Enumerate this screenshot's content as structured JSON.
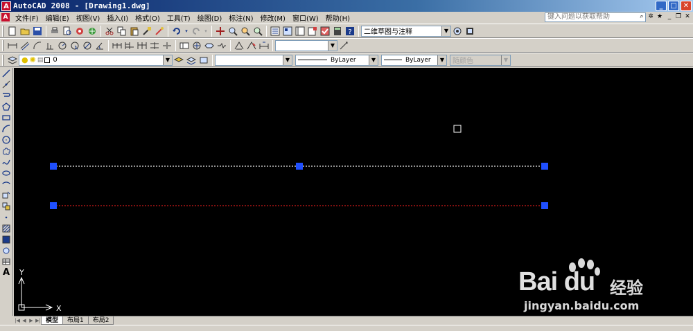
{
  "window": {
    "title": "AutoCAD 2008 - [Drawing1.dwg]",
    "app_icon_letter": "A",
    "controls": {
      "minimize": "_",
      "maximize": "□",
      "close": "✕"
    }
  },
  "menubar": {
    "items": [
      "文件(F)",
      "编辑(E)",
      "视图(V)",
      "插入(I)",
      "格式(O)",
      "工具(T)",
      "绘图(D)",
      "标注(N)",
      "修改(M)",
      "窗口(W)",
      "帮助(H)"
    ],
    "help_placeholder": "键入问题以获取帮助"
  },
  "toolbar_standard": {
    "workspace_value": "二维草图与注释"
  },
  "toolbar_dimension": {
    "dimstyle_value": ""
  },
  "toolbar_layers": {
    "layer_value": "0",
    "layer_state_value": ""
  },
  "toolbar_properties": {
    "color_value": "",
    "linetype_value": "ByLayer",
    "lineweight_value": "ByLayer",
    "plotstyle_value": "随颜色"
  },
  "left_palette": {
    "text_tool_label": "A"
  },
  "canvas": {
    "background": "#000000",
    "grip_color": "#1f4fff",
    "line1_color": "#e6e6e6",
    "line2_color": "#cc1a1a",
    "ucs_x_label": "X",
    "ucs_y_label": "Y"
  },
  "layout_tabs": [
    {
      "label": "模型",
      "active": true
    },
    {
      "label": "布局1",
      "active": false
    },
    {
      "label": "布局2",
      "active": false
    }
  ],
  "watermark": {
    "brand": "Bai du",
    "cn": "经验",
    "url": "jingyan.baidu.com"
  }
}
